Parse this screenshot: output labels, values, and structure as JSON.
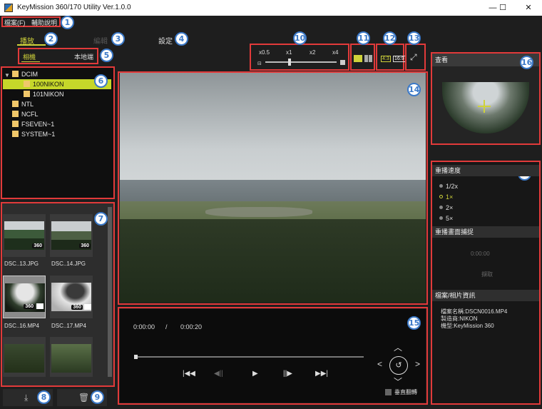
{
  "window": {
    "title": "KeyMission 360/170 Utility Ver.1.0.0",
    "minimize": "—",
    "maximize": "☐",
    "close": "✕"
  },
  "menu": {
    "file": "檔案(F)",
    "help": "輔助說明"
  },
  "tabs": {
    "playback": "播放",
    "edit": "編輯",
    "settings": "設定"
  },
  "source_tabs": {
    "camera": "相機",
    "local": "本地端"
  },
  "tree": {
    "items": [
      {
        "label": "DCIM"
      },
      {
        "label": "100NIKON"
      },
      {
        "label": "101NIKON"
      },
      {
        "label": "NTL"
      },
      {
        "label": "NCFL"
      },
      {
        "label": "FSEVEN~1"
      },
      {
        "label": "SYSTEM~1"
      }
    ]
  },
  "thumbnails": [
    {
      "label": "DSC..13.JPG",
      "badge": "360"
    },
    {
      "label": "DSC..14.JPG",
      "badge": "360"
    },
    {
      "label": "DSC..16.MP4",
      "badge": "360"
    },
    {
      "label": "DSC..17.MP4",
      "badge": "360"
    }
  ],
  "zoom": {
    "labels": [
      "x0.5",
      "x1",
      "x2",
      "x4"
    ]
  },
  "ratio": {
    "r43": "4:3",
    "r169": "16:9"
  },
  "playback": {
    "current_time": "0:00:00",
    "separator": "/",
    "total_time": "0:00:20",
    "vertical_flip": "垂直翻轉"
  },
  "preview": {
    "title": "查看"
  },
  "speed": {
    "title": "重播速度",
    "options": [
      "1/2x",
      "1×",
      "2×",
      "5×"
    ],
    "selected": "1×"
  },
  "capture": {
    "title": "重播畫面捕捉",
    "time": "0:00:00",
    "button": "擷取"
  },
  "file_info": {
    "title": "檔案/相片資訊",
    "name": "檔案名稱:DSCN0016.MP4",
    "maker": "製造商:NIKON",
    "model": "機型:KeyMission 360"
  },
  "callouts": [
    "1",
    "2",
    "3",
    "4",
    "5",
    "6",
    "7",
    "8",
    "9",
    "10",
    "11",
    "12",
    "13",
    "14",
    "15",
    "16",
    "17"
  ],
  "colors": {
    "accent": "#cfd23a",
    "callout": "#3b79c8",
    "highlight": "#e23a3a"
  }
}
